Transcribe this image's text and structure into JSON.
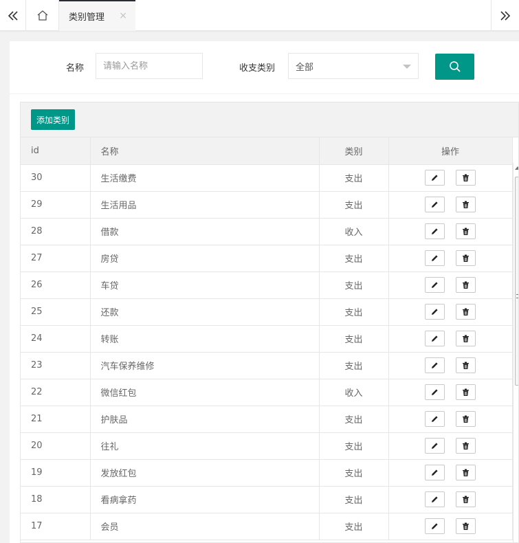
{
  "tabs": {
    "active_tab": {
      "label": "类别管理",
      "close": "×"
    }
  },
  "search": {
    "name_label": "名称",
    "name_placeholder": "请输入名称",
    "category_label": "收支类别",
    "category_selected": "全部"
  },
  "toolbar": {
    "add_label": "添加类别"
  },
  "table": {
    "headers": {
      "id": "id",
      "name": "名称",
      "type": "类别",
      "actions": "操作"
    },
    "rows": [
      {
        "id": "30",
        "name": "生活缴费",
        "type": "支出"
      },
      {
        "id": "29",
        "name": "生活用品",
        "type": "支出"
      },
      {
        "id": "28",
        "name": "借款",
        "type": "收入"
      },
      {
        "id": "27",
        "name": "房贷",
        "type": "支出"
      },
      {
        "id": "26",
        "name": "车贷",
        "type": "支出"
      },
      {
        "id": "25",
        "name": "还款",
        "type": "支出"
      },
      {
        "id": "24",
        "name": "转账",
        "type": "支出"
      },
      {
        "id": "23",
        "name": "汽车保养维修",
        "type": "支出"
      },
      {
        "id": "22",
        "name": "微信红包",
        "type": "收入"
      },
      {
        "id": "21",
        "name": "护肤品",
        "type": "支出"
      },
      {
        "id": "20",
        "name": "往礼",
        "type": "支出"
      },
      {
        "id": "19",
        "name": "发放红包",
        "type": "支出"
      },
      {
        "id": "18",
        "name": "看病拿药",
        "type": "支出"
      },
      {
        "id": "17",
        "name": "会员",
        "type": "支出"
      }
    ]
  },
  "colors": {
    "primary": "#009688",
    "border": "#e6e6e6",
    "header_bg": "#f2f2f2"
  },
  "icons": {
    "tab_left": "double-chevron-left-icon",
    "home": "home-icon",
    "tab_right": "double-chevron-right-icon",
    "search": "search-icon",
    "edit": "pencil-icon",
    "delete": "trash-icon"
  }
}
